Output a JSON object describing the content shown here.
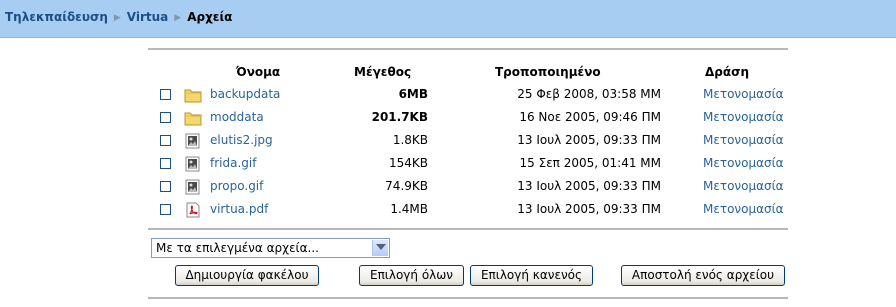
{
  "breadcrumb": {
    "items": [
      {
        "label": "Τηλεκπαίδευση"
      },
      {
        "label": "Virtua"
      }
    ],
    "current": "Αρχεία"
  },
  "table": {
    "headers": {
      "name": "Όνομα",
      "size": "Μέγεθος",
      "modified": "Τροποποιημένο",
      "action": "Δράση"
    },
    "rows": [
      {
        "name": "backupdata",
        "size": "6MB",
        "modified": "25 Φεβ 2008, 03:58 ΜΜ",
        "action": "Μετονομασία",
        "icon": "folder-icon"
      },
      {
        "name": "moddata",
        "size": "201.7KB",
        "modified": "16 Νοε 2005, 09:46 ΠΜ",
        "action": "Μετονομασία",
        "icon": "folder-icon"
      },
      {
        "name": "elutis2.jpg",
        "size": "1.8KB",
        "modified": "13 Ιουλ 2005, 09:33 ΠΜ",
        "action": "Μετονομασία",
        "icon": "image-file-icon"
      },
      {
        "name": "frida.gif",
        "size": "154KB",
        "modified": "15 Σεπ 2005, 01:41 ΜΜ",
        "action": "Μετονομασία",
        "icon": "image-file-icon"
      },
      {
        "name": "propo.gif",
        "size": "74.9KB",
        "modified": "13 Ιουλ 2005, 09:33 ΠΜ",
        "action": "Μετονομασία",
        "icon": "image-file-icon"
      },
      {
        "name": "virtua.pdf",
        "size": "1.4MB",
        "modified": "13 Ιουλ 2005, 09:33 ΠΜ",
        "action": "Μετονομασία",
        "icon": "pdf-file-icon"
      }
    ]
  },
  "bulk_select": {
    "selected": "Με τα επιλεγμένα αρχεία..."
  },
  "buttons": {
    "create_folder": "Δημιουργία φακέλου",
    "select_all": "Επιλογή όλων",
    "select_none": "Επιλογή κανενός",
    "upload": "Αποστολή ενός αρχείου"
  },
  "colors": {
    "navbar": "#a8cdf2",
    "link": "#2a6496",
    "folder": "#f5d76e"
  }
}
